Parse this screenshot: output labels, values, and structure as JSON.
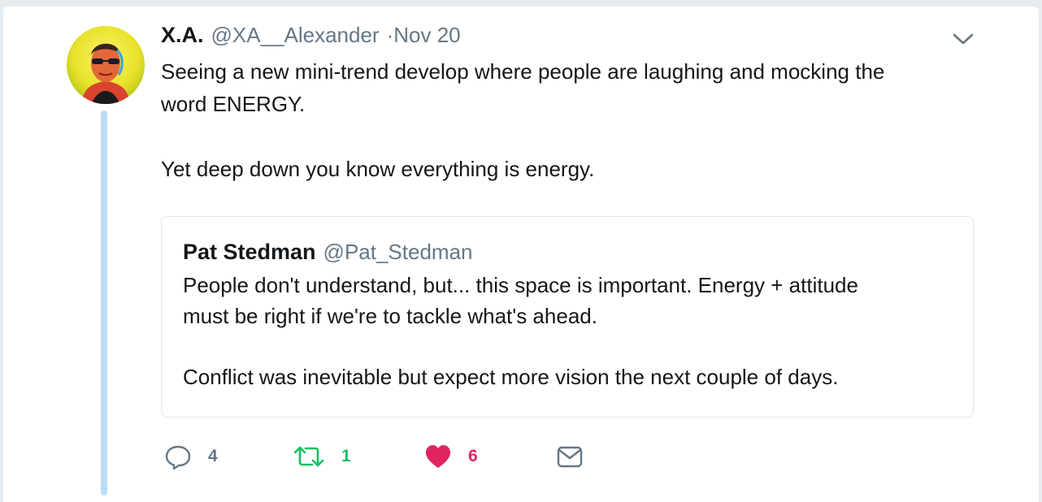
{
  "tweet": {
    "author_name": "X.A.",
    "author_handle": "@XA__Alexander",
    "separator": "·",
    "timestamp": "Nov 20",
    "text": "Seeing a new mini-trend develop where people are laughing and mocking the\nword ENERGY.\n\nYet deep down you know everything is energy."
  },
  "quoted_tweet": {
    "author_name": "Pat Stedman",
    "author_handle": "@Pat_Stedman",
    "text": "People don't understand, but... this space is important. Energy + attitude\nmust be right if we're to tackle what's ahead.\n\nConflict was inevitable but expect more vision the next couple of days."
  },
  "actions": {
    "reply_count": "4",
    "retweet_count": "1",
    "like_count": "6"
  },
  "icons": {
    "menu": "chevron-down-icon",
    "reply": "reply-icon",
    "retweet": "retweet-icon",
    "like": "heart-icon",
    "dm": "envelope-icon"
  },
  "colors": {
    "text": "#14171a",
    "muted": "#657786",
    "thread_line": "#bcdcf5",
    "retweet_green": "#17bf63",
    "like_red": "#e0245e"
  }
}
